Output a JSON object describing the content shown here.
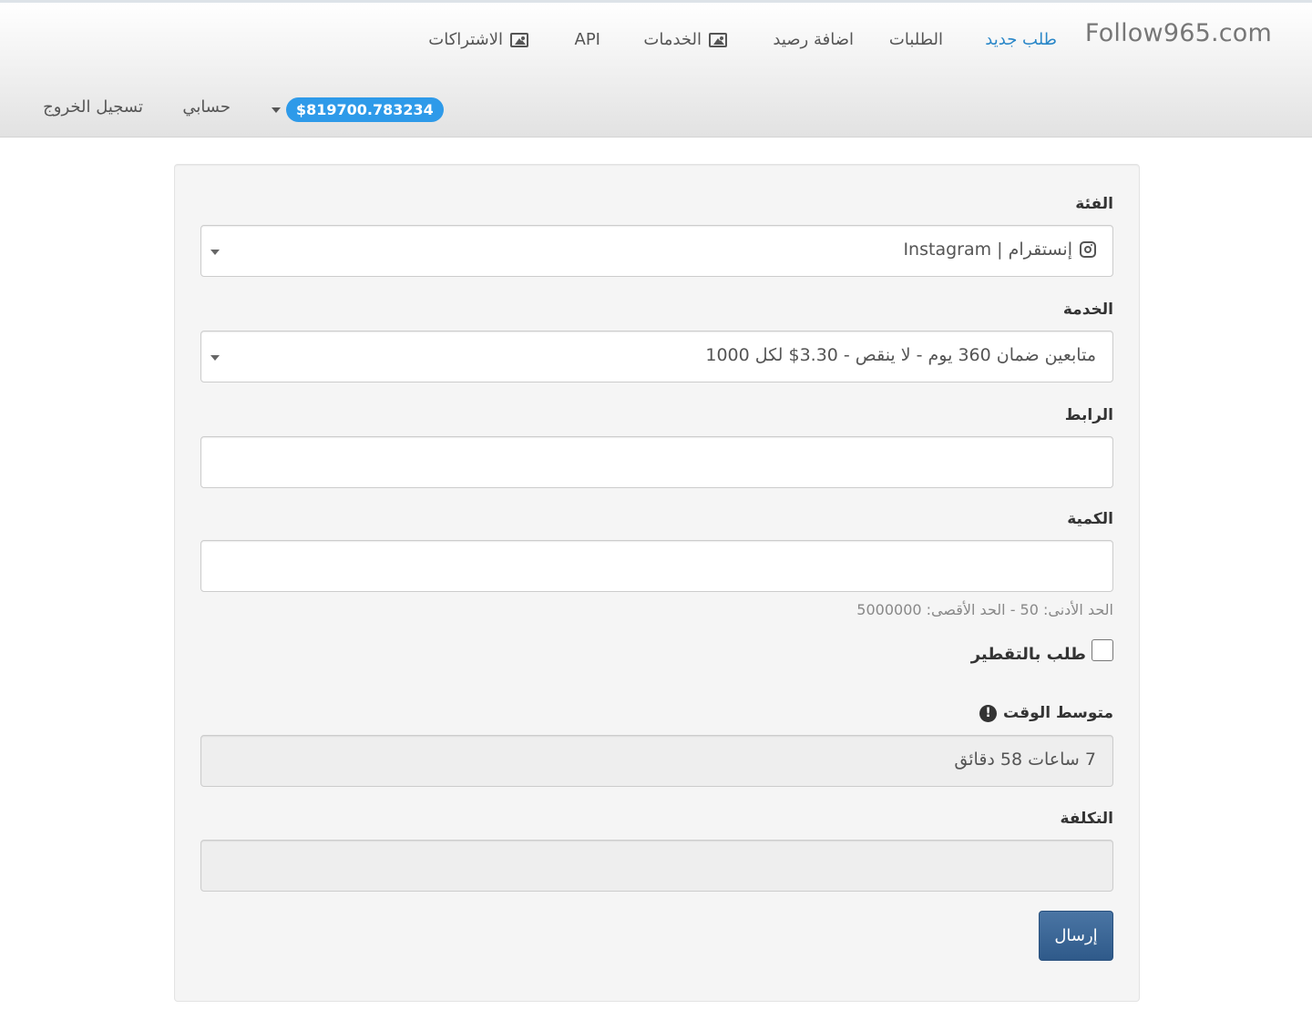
{
  "navbar": {
    "brand": "Follow965.com",
    "links": [
      {
        "label": "طلب جديد",
        "active": true
      },
      {
        "label": "الطلبات"
      },
      {
        "label": "اضافة رصيد"
      },
      {
        "label": "الخدمات",
        "icon": "image-icon"
      },
      {
        "label": "API"
      },
      {
        "label": "الاشتراكات",
        "icon": "image-icon"
      }
    ],
    "balance": "$819700.783234",
    "account": "حسابي",
    "logout": "تسجيل الخروج",
    "colors": {
      "active": "#2a87c8",
      "badge": "#2e9ae9"
    }
  },
  "form": {
    "category": {
      "label": "الفئة",
      "value": "إنستقرام | Instagram",
      "icon": "instagram-icon"
    },
    "service": {
      "label": "الخدمة",
      "value": "متابعين ضمان 360 يوم - لا ينقص - 3.30$ لكل 1000"
    },
    "link": {
      "label": "الرابط",
      "value": ""
    },
    "quantity": {
      "label": "الكمية",
      "value": "",
      "help": "الحد الأدنى: 50 - الحد الأقصى: 5000000"
    },
    "drip_feed": {
      "label": "طلب بالتقطير",
      "checked": false
    },
    "average_time": {
      "label": "متوسط الوقت",
      "value": "7 ساعات 58 دقائق",
      "icon": "exclamation-circle-icon"
    },
    "charge": {
      "label": "التكلفة",
      "value": ""
    },
    "submit_label": "إرسال",
    "colors": {
      "submit": "#3b6796"
    }
  }
}
